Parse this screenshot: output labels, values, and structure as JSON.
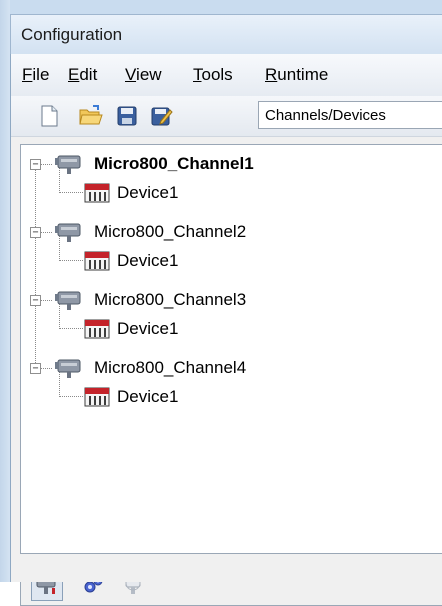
{
  "window": {
    "title": "Configuration"
  },
  "menu": [
    {
      "label": "File",
      "mnemonic": "F",
      "rest": "ile"
    },
    {
      "label": "Edit",
      "mnemonic": "E",
      "rest": "dit"
    },
    {
      "label": "View",
      "mnemonic": "V",
      "rest": "iew"
    },
    {
      "label": "Tools",
      "mnemonic": "T",
      "rest": "ools"
    },
    {
      "label": "Runtime",
      "mnemonic": "R",
      "rest": "untime"
    }
  ],
  "toolbar": {
    "icons": [
      "new-document-icon",
      "open-folder-icon",
      "save-icon",
      "save-as-icon"
    ],
    "view_selector": "Channels/Devices"
  },
  "tree": {
    "nodes": [
      {
        "name": "Micro800_Channel1",
        "bold": true,
        "expanded": true,
        "children": [
          {
            "name": "Device1"
          }
        ]
      },
      {
        "name": "Micro800_Channel2",
        "bold": false,
        "expanded": true,
        "children": [
          {
            "name": "Device1"
          }
        ]
      },
      {
        "name": "Micro800_Channel3",
        "bold": false,
        "expanded": true,
        "children": [
          {
            "name": "Device1"
          }
        ]
      },
      {
        "name": "Micro800_Channel4",
        "bold": false,
        "expanded": true,
        "children": [
          {
            "name": "Device1"
          }
        ]
      }
    ],
    "expander_symbol": "−"
  },
  "bottom_toolbar": {
    "icons": [
      "channel-view-icon",
      "tools-gear-icon",
      "runtime-view-icon"
    ]
  },
  "colors": {
    "window_frame": "#c9dcef",
    "selection": "#dfe7f1"
  }
}
